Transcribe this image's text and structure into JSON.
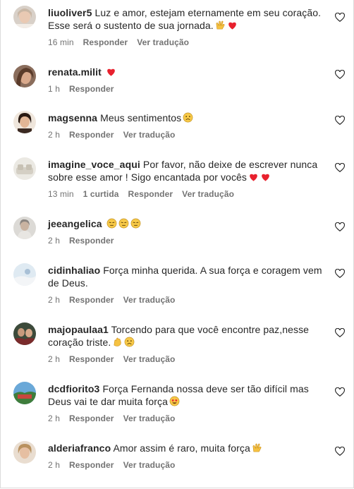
{
  "labels": {
    "reply": "Responder",
    "translate": "Ver tradução"
  },
  "comments": [
    {
      "username": "liuoliver5",
      "text": "Luz e amor, estejam eternamente em seu coração. Esse será o sustento de sua jornada.",
      "time": "16 min",
      "likes": "",
      "emojis": [
        "raised-hands-icon",
        "heart-icon"
      ]
    },
    {
      "username": "renata.milit",
      "text": "",
      "time": "1 h",
      "likes": "",
      "emojis": [
        "heart-icon"
      ]
    },
    {
      "username": "magsenna",
      "text": "Meus sentimentos",
      "time": "2 h",
      "likes": "",
      "emojis": [
        "sad-face-icon"
      ]
    },
    {
      "username": "imagine_voce_aqui",
      "text": "Por favor, não deixe de escrever nunca sobre esse amor ! Sigo encantada por vocês",
      "time": "13 min",
      "likes": "1 curtida",
      "emojis": [
        "heart-icon",
        "heart-icon"
      ]
    },
    {
      "username": "jeeangelica",
      "text": "",
      "time": "2 h",
      "likes": "",
      "emojis": [
        "pensive-face-icon",
        "pensive-face-icon",
        "pensive-face-icon"
      ]
    },
    {
      "username": "cidinhaliao",
      "text": "Força minha querida. A sua força e coragem vem de Deus.",
      "time": "2 h",
      "likes": "",
      "emojis": []
    },
    {
      "username": "majopaulaa1",
      "text": "Torcendo para que você encontre paz,nesse coração triste.",
      "time": "2 h",
      "likes": "",
      "emojis": [
        "clapping-hands-icon",
        "sad-face-icon"
      ]
    },
    {
      "username": "dcdfiorito3",
      "text": "Força Fernanda nossa deve ser tão difícil mas Deus vai te dar muita força",
      "time": "2 h",
      "likes": "",
      "emojis": [
        "star-struck-face-icon"
      ]
    },
    {
      "username": "alderiafranco",
      "text": "Amor assim é raro, muita força",
      "time": "2 h",
      "likes": "",
      "emojis": [
        "raised-hands-icon"
      ]
    }
  ],
  "colors": {
    "username": "#262626",
    "meta": "#737373",
    "heart": "#ff3040",
    "divider": "#dbdbdb"
  }
}
